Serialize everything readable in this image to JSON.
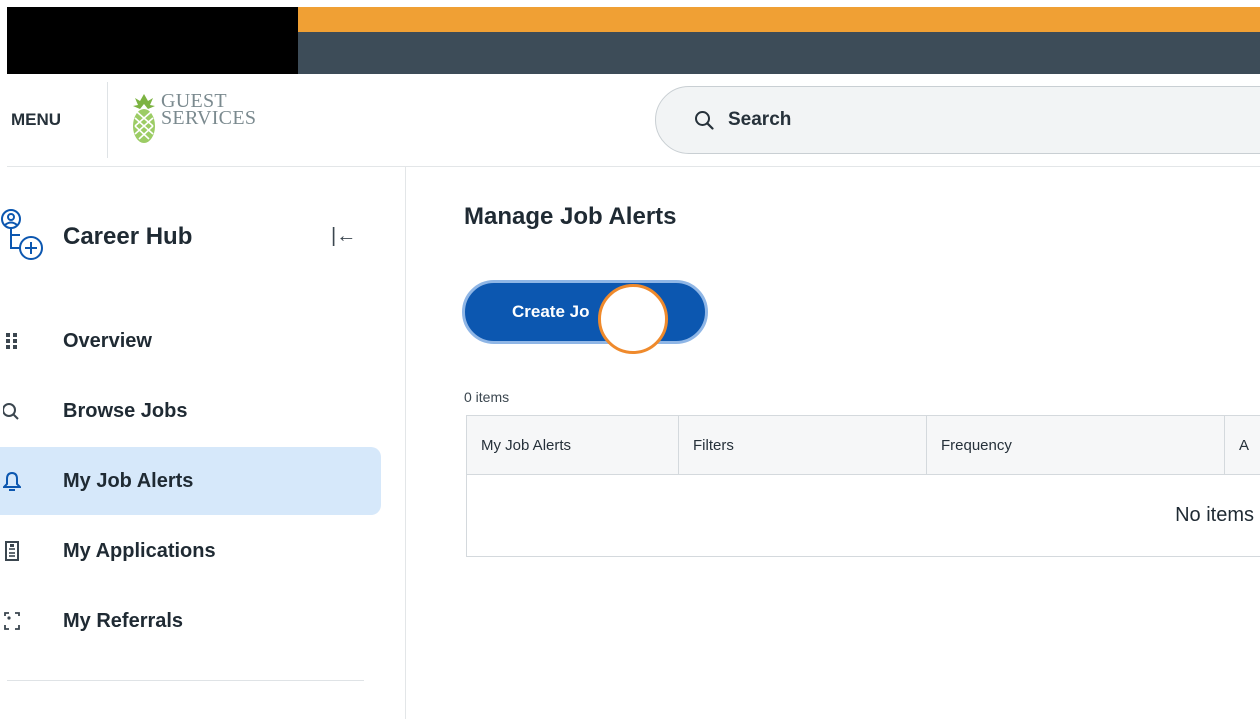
{
  "header": {
    "menu_label": "MENU",
    "logo": {
      "line1": "GUEST",
      "line2": "SERVICES"
    },
    "search_label": "Search"
  },
  "sidebar": {
    "title": "Career Hub",
    "items": [
      {
        "label": "Overview",
        "icon": "grid-icon"
      },
      {
        "label": "Browse Jobs",
        "icon": "search-icon"
      },
      {
        "label": "My Job Alerts",
        "icon": "bell-icon",
        "active": true
      },
      {
        "label": "My Applications",
        "icon": "document-icon"
      },
      {
        "label": "My Referrals",
        "icon": "referral-icon"
      }
    ]
  },
  "main": {
    "title": "Manage Job Alerts",
    "create_button_label": "Create Jo",
    "item_count": "0 items",
    "table": {
      "columns": [
        "My Job Alerts",
        "Filters",
        "Frequency",
        "A"
      ],
      "empty_text": "No items"
    }
  },
  "colors": {
    "orange_banner": "#f0a034",
    "dark_banner": "#3d4c58",
    "primary_button": "#0c57b0",
    "active_nav_bg": "#d6e8fa",
    "click_marker": "#ef8a2c"
  }
}
